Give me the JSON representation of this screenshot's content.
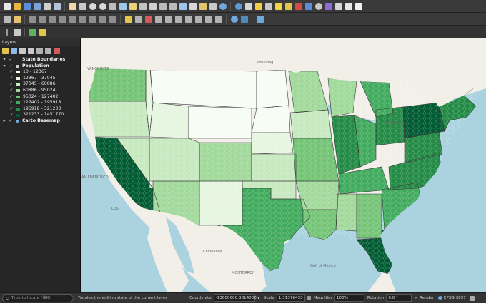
{
  "panel": {
    "title": "Layers",
    "layers": [
      {
        "label": "State Boundaries"
      },
      {
        "label": "Population"
      },
      {
        "label": "Carto Basemap"
      }
    ],
    "legend": [
      {
        "label": "10 - 12367",
        "color": "#f7fcf5"
      },
      {
        "label": "12367 - 37045",
        "color": "#e5f5e0"
      },
      {
        "label": "37045 - 60886",
        "color": "#c7e9c0"
      },
      {
        "label": "60886 - 95024",
        "color": "#a1d99b"
      },
      {
        "label": "95024 - 127402",
        "color": "#74c476"
      },
      {
        "label": "127402 - 195918",
        "color": "#41ab5d"
      },
      {
        "label": "195918 - 321233",
        "color": "#238b45"
      },
      {
        "label": "321233 - 1451770",
        "color": "#005a32"
      }
    ]
  },
  "map": {
    "labels": [
      {
        "text": "VANCOUVER"
      },
      {
        "text": "Winnipeg"
      },
      {
        "text": "ORONTO"
      },
      {
        "text": "AN FRANCISCO"
      },
      {
        "text": "LOS"
      },
      {
        "text": "Chihuahua"
      },
      {
        "text": "MONTERREY"
      },
      {
        "text": "Gulf of Mexico"
      }
    ]
  },
  "status": {
    "locate_placeholder": "Type to locate (⌘K)",
    "message": "Toggles the editing state of the current layer",
    "coordinate_label": "Coordinate",
    "coordinate_value": "-13600600,3814000",
    "scale_label": "Scale",
    "scale_value": "1:31376433",
    "magnifier_label": "Magnifier",
    "magnifier_value": "100%",
    "rotation_label": "Rotation",
    "rotation_value": "0.0 °",
    "render_label": "Render",
    "crs_label": "EPSG:3857"
  },
  "colors": {
    "land": "#f2efe9",
    "water": "#aad3df",
    "border": "#3a3a3a"
  }
}
